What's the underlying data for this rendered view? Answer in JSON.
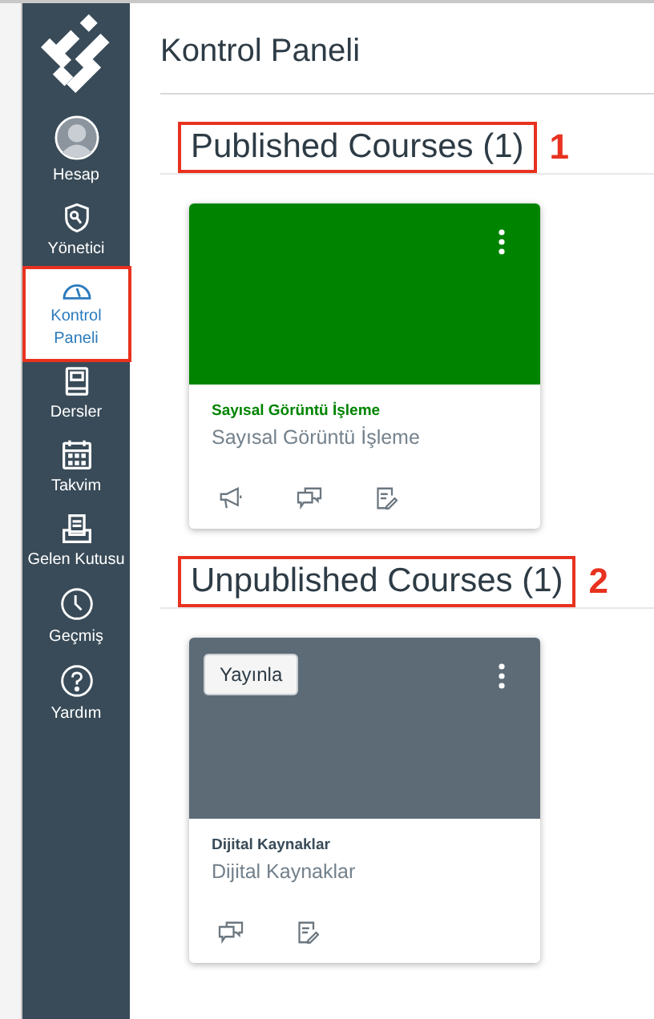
{
  "sidebar": {
    "items": [
      {
        "kind": "account",
        "label": "Hesap",
        "selected": false
      },
      {
        "kind": "admin",
        "label": "Yönetici",
        "selected": false
      },
      {
        "kind": "dashboard",
        "label": "Kontrol Paneli",
        "selected": true
      },
      {
        "kind": "courses",
        "label": "Dersler",
        "selected": false
      },
      {
        "kind": "calendar",
        "label": "Takvim",
        "selected": false
      },
      {
        "kind": "inbox",
        "label": "Gelen Kutusu",
        "selected": false
      },
      {
        "kind": "history",
        "label": "Geçmiş",
        "selected": false
      },
      {
        "kind": "help",
        "label": "Yardım",
        "selected": false
      }
    ]
  },
  "page_title": "Kontrol Paneli",
  "sections": [
    {
      "heading": "Published Courses (1)",
      "callout": "1",
      "courses": [
        {
          "kind": "published",
          "color": "#008400",
          "title": "Sayısal Görüntü İşleme",
          "subtitle": "Sayısal Görüntü İşleme",
          "actions": [
            {
              "kind": "announcements"
            },
            {
              "kind": "discussions"
            },
            {
              "kind": "assignments"
            }
          ]
        }
      ]
    },
    {
      "heading": "Unpublished Courses (1)",
      "callout": "2",
      "courses": [
        {
          "kind": "unpublished",
          "color": "#5d6b77",
          "publish_button": "Yayınla",
          "title": "Dijital Kaynaklar",
          "subtitle": "Dijital Kaynaklar",
          "actions": [
            {
              "kind": "discussions"
            },
            {
              "kind": "assignments"
            }
          ]
        }
      ]
    }
  ]
}
